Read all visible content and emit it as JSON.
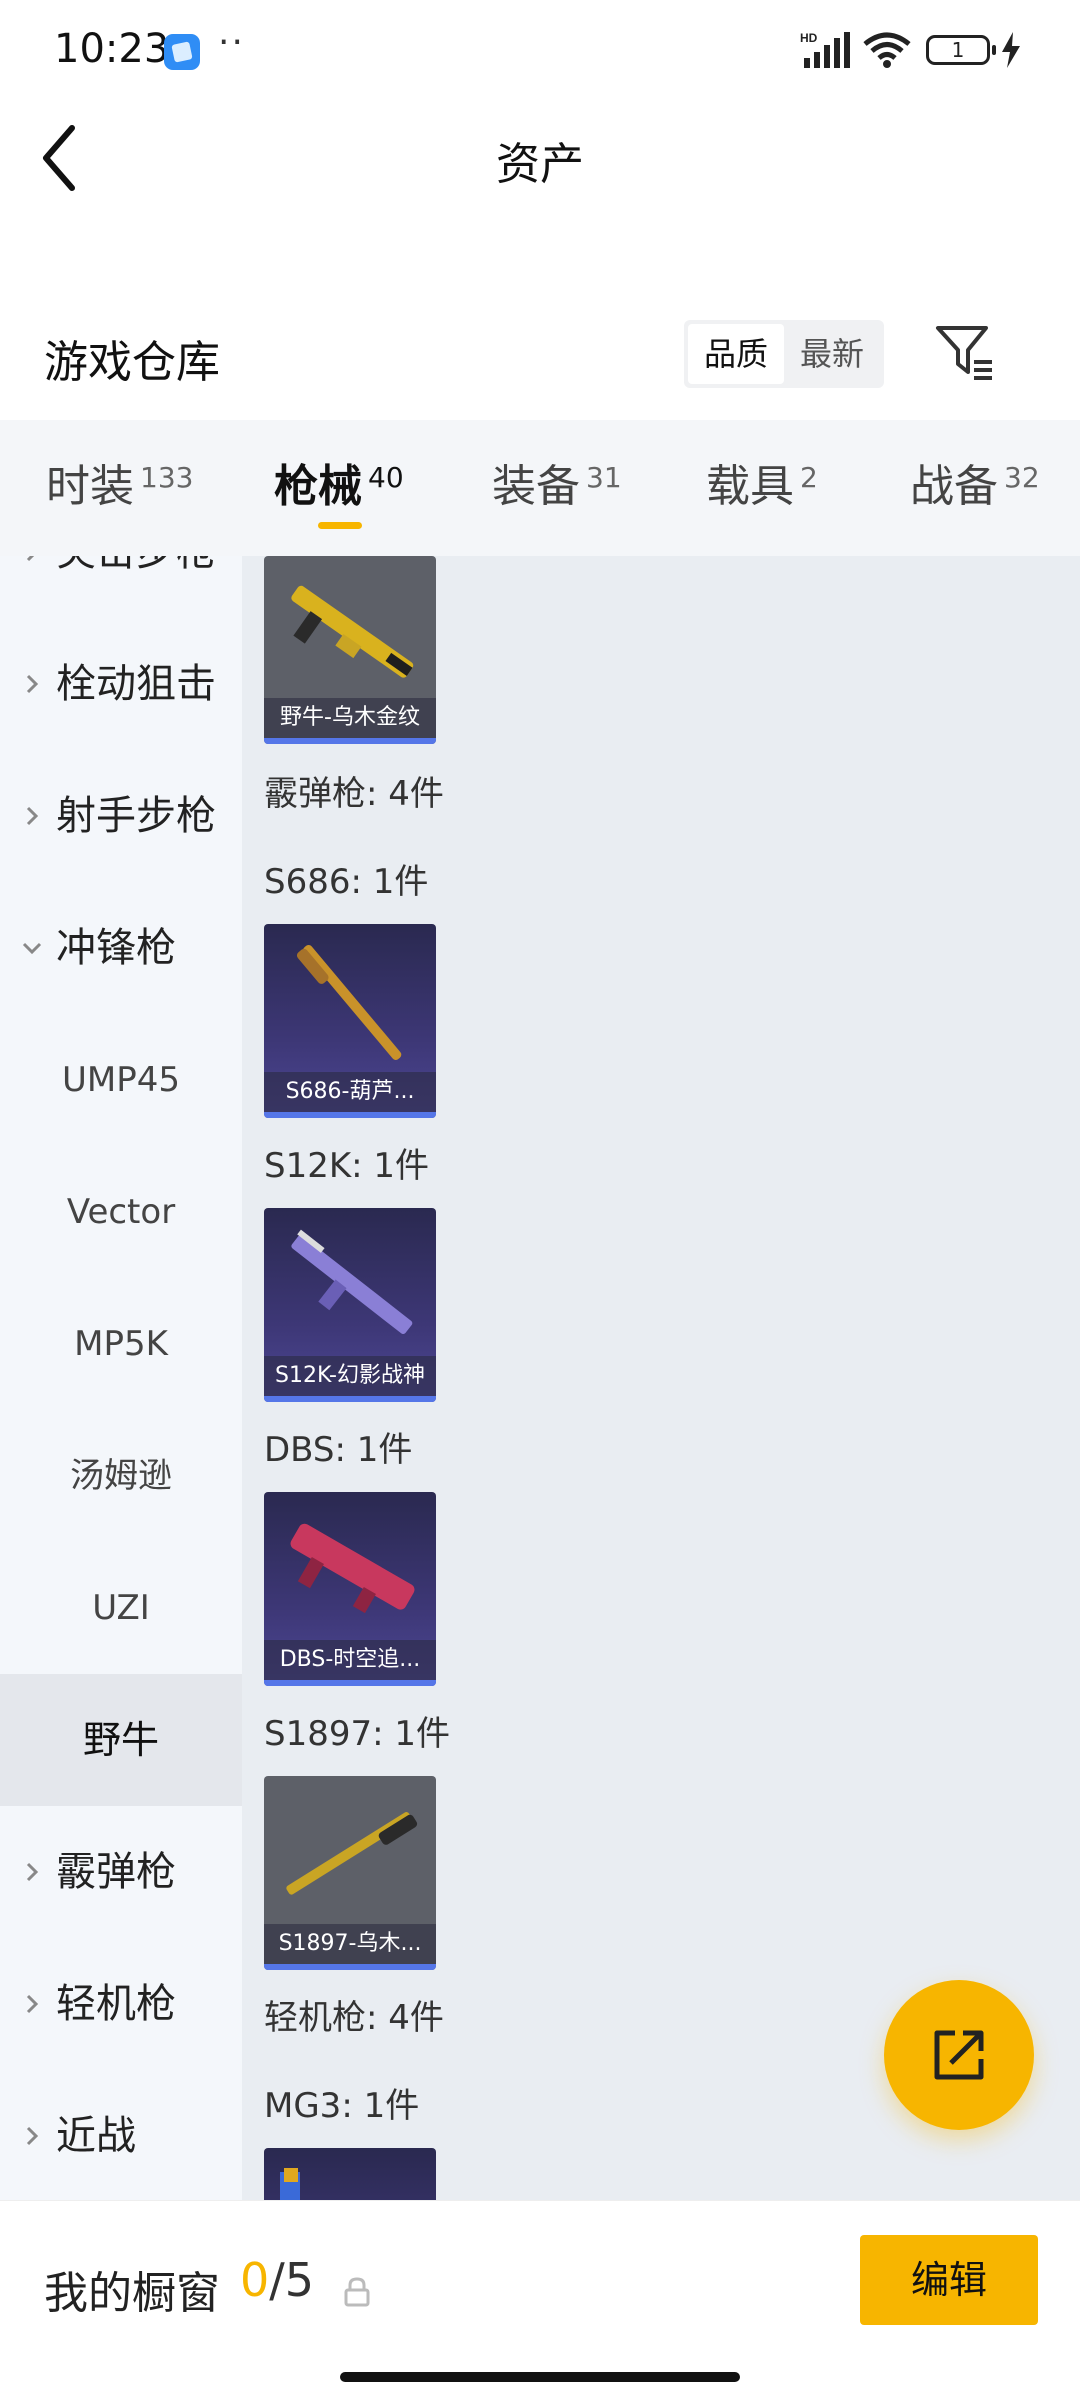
{
  "status_bar": {
    "time": "10:23",
    "dots": "··",
    "battery": "1",
    "icons": [
      "app-icon",
      "signal-icon",
      "wifi-icon",
      "battery-icon",
      "charging-icon"
    ]
  },
  "header": {
    "title": "资产"
  },
  "section": {
    "title": "游戏仓库",
    "sort_quality": "品质",
    "sort_newest": "最新"
  },
  "tabs": [
    {
      "label": "时装",
      "count": "133"
    },
    {
      "label": "枪械",
      "count": "40",
      "active": true
    },
    {
      "label": "装备",
      "count": "31"
    },
    {
      "label": "载具",
      "count": "2"
    },
    {
      "label": "战备",
      "count": "32"
    }
  ],
  "sidebar": {
    "partial_top": "突击步枪",
    "categories": [
      {
        "label": "栓动狙击",
        "expanded": false
      },
      {
        "label": "射手步枪",
        "expanded": false
      },
      {
        "label": "冲锋枪",
        "expanded": true
      }
    ],
    "subitems": [
      "UMP45",
      "Vector",
      "MP5K",
      "汤姆逊",
      "UZI",
      "野牛"
    ],
    "active_subitem": "野牛",
    "after": [
      {
        "label": "霰弹枪"
      },
      {
        "label": "轻机枪"
      },
      {
        "label": "近战"
      }
    ]
  },
  "content": {
    "groups": [
      "霰弹枪: 4件",
      "S686: 1件",
      "S12K: 1件",
      "DBS: 1件",
      "S1897: 1件",
      "轻机枪: 4件",
      "MG3: 1件"
    ],
    "cards": [
      {
        "caption": "野牛-乌木金纹",
        "style": "gray",
        "accent": "#d9b21e"
      },
      {
        "caption": "S686-葫芦...",
        "style": "purple",
        "accent": "#c9922a"
      },
      {
        "caption": "S12K-幻影战神",
        "style": "purple",
        "accent": "#8a7fd6"
      },
      {
        "caption": "DBS-时空追...",
        "style": "purple",
        "accent": "#c8385e"
      },
      {
        "caption": "S1897-乌木...",
        "style": "gray",
        "accent": "#c9a524"
      }
    ]
  },
  "bottom_bar": {
    "label": "我的橱窗",
    "current": "0",
    "separator": "/",
    "total": "5",
    "edit": "编辑"
  },
  "colors": {
    "accent": "#f7b500",
    "card_bar": "#5576e8",
    "content_bg": "#e9edf2",
    "sidebar_bg": "#f4f7fb"
  }
}
